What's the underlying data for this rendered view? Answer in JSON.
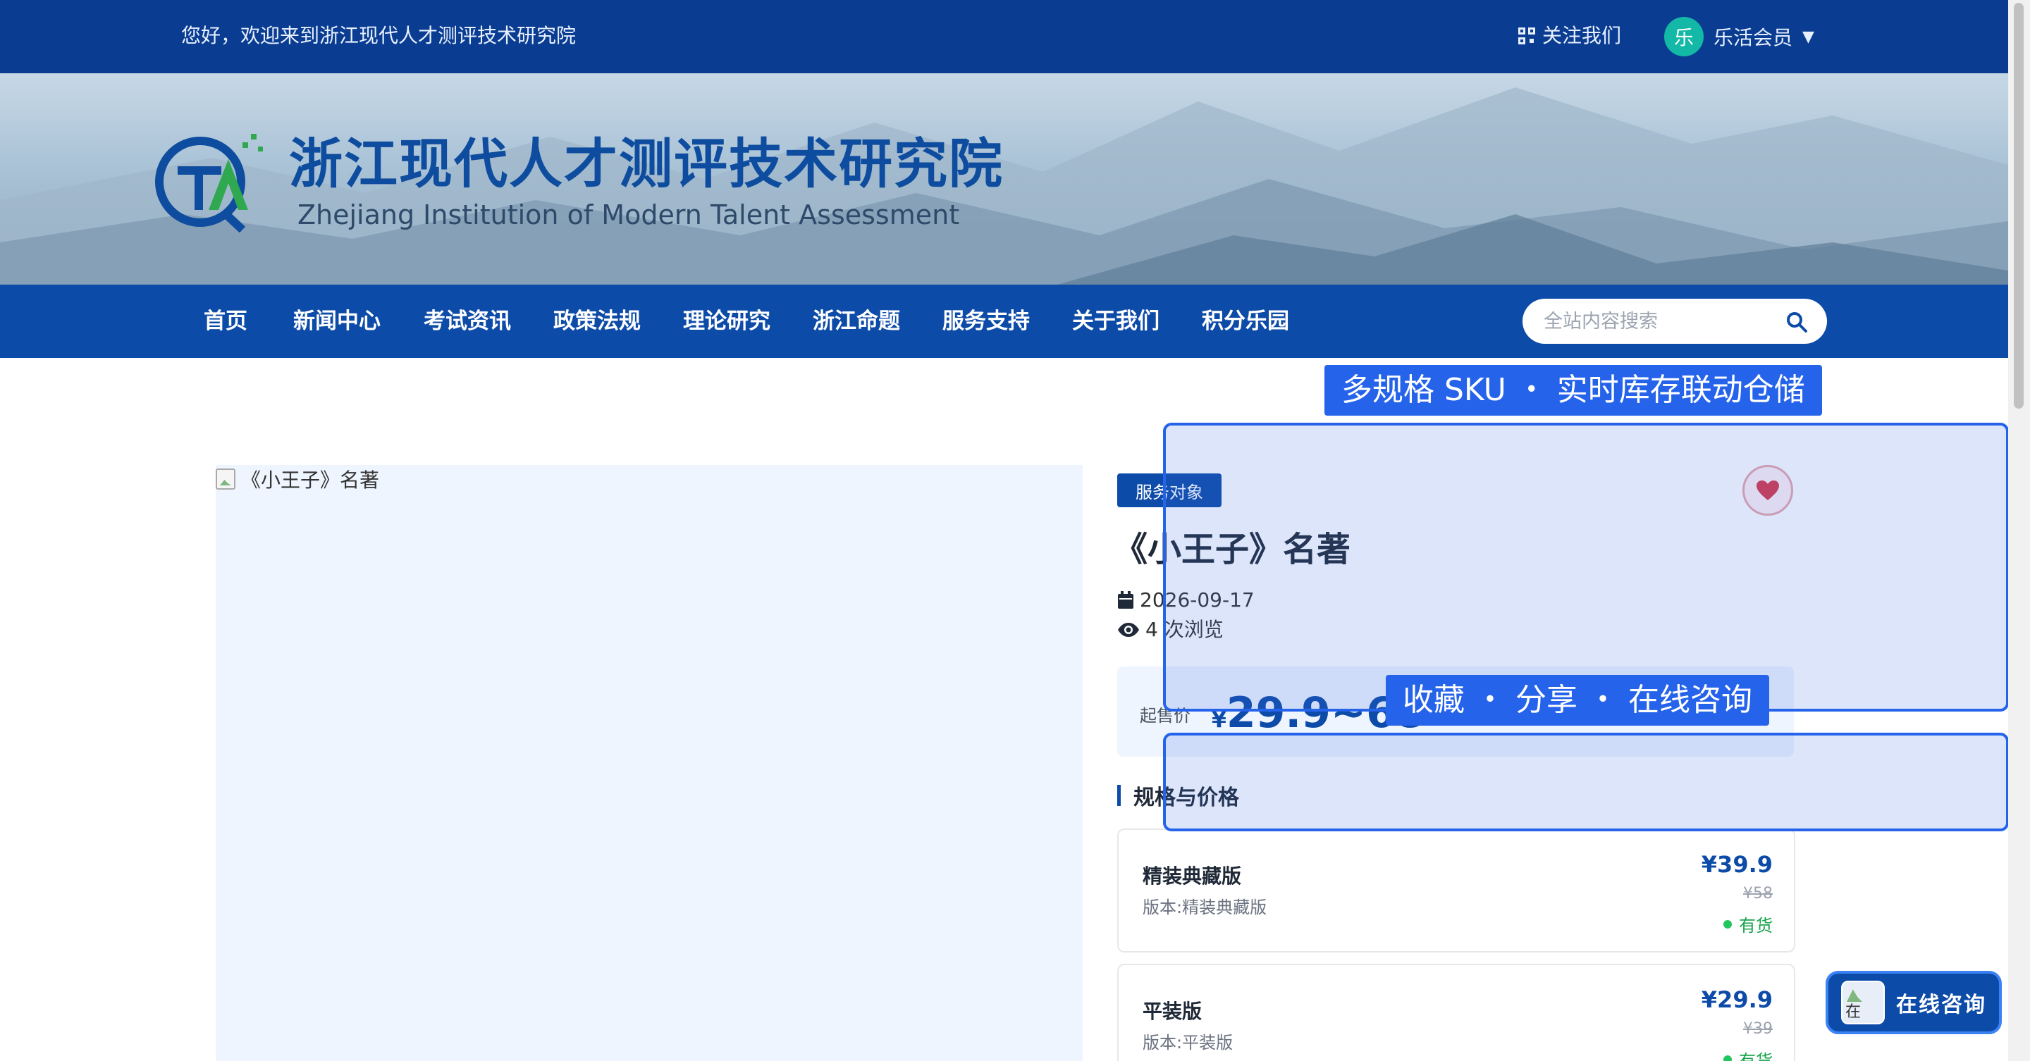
{
  "topbar": {
    "welcome": "您好，欢迎来到浙江现代人才测评技术研究院",
    "follow": "关注我们",
    "member_avatar": "乐",
    "member_label": "乐活会员"
  },
  "banner": {
    "title": "浙江现代人才测评技术研究院",
    "subtitle": "Zhejiang Institution of Modern Talent Assessment"
  },
  "nav": {
    "items": [
      "首页",
      "新闻中心",
      "考试资讯",
      "政策法规",
      "理论研究",
      "浙江命题",
      "服务支持",
      "关于我们",
      "积分乐园"
    ],
    "search_placeholder": "全站内容搜索"
  },
  "product": {
    "image_alt": "《小王子》名著",
    "badge": "服务对象",
    "title": "《小王子》名著",
    "date": "2026-09-17",
    "views": "4 次浏览",
    "price_label": "起售价",
    "price_currency": "¥",
    "price_range": "29.9~68",
    "spec_heading": "规格与价格",
    "skus": [
      {
        "name": "精装典藏版",
        "desc": "版本:精装典藏版",
        "price": "¥39.9",
        "original": "¥58",
        "stock": "有货"
      },
      {
        "name": "平装版",
        "desc": "版本:平装版",
        "price": "¥29.9",
        "original": "¥39",
        "stock": "有货"
      }
    ]
  },
  "overlays": {
    "label1": "多规格 SKU ・ 实时库存联动仓储",
    "label2": "收藏 ・ 分享 ・ 在线咨询"
  },
  "consult": {
    "icon_alt": "在",
    "label": "在线咨询"
  },
  "colors": {
    "primary": "#0d4ba8",
    "topbar": "#0a3d91",
    "overlay": "#2563eb",
    "in_stock": "#16a34a"
  }
}
